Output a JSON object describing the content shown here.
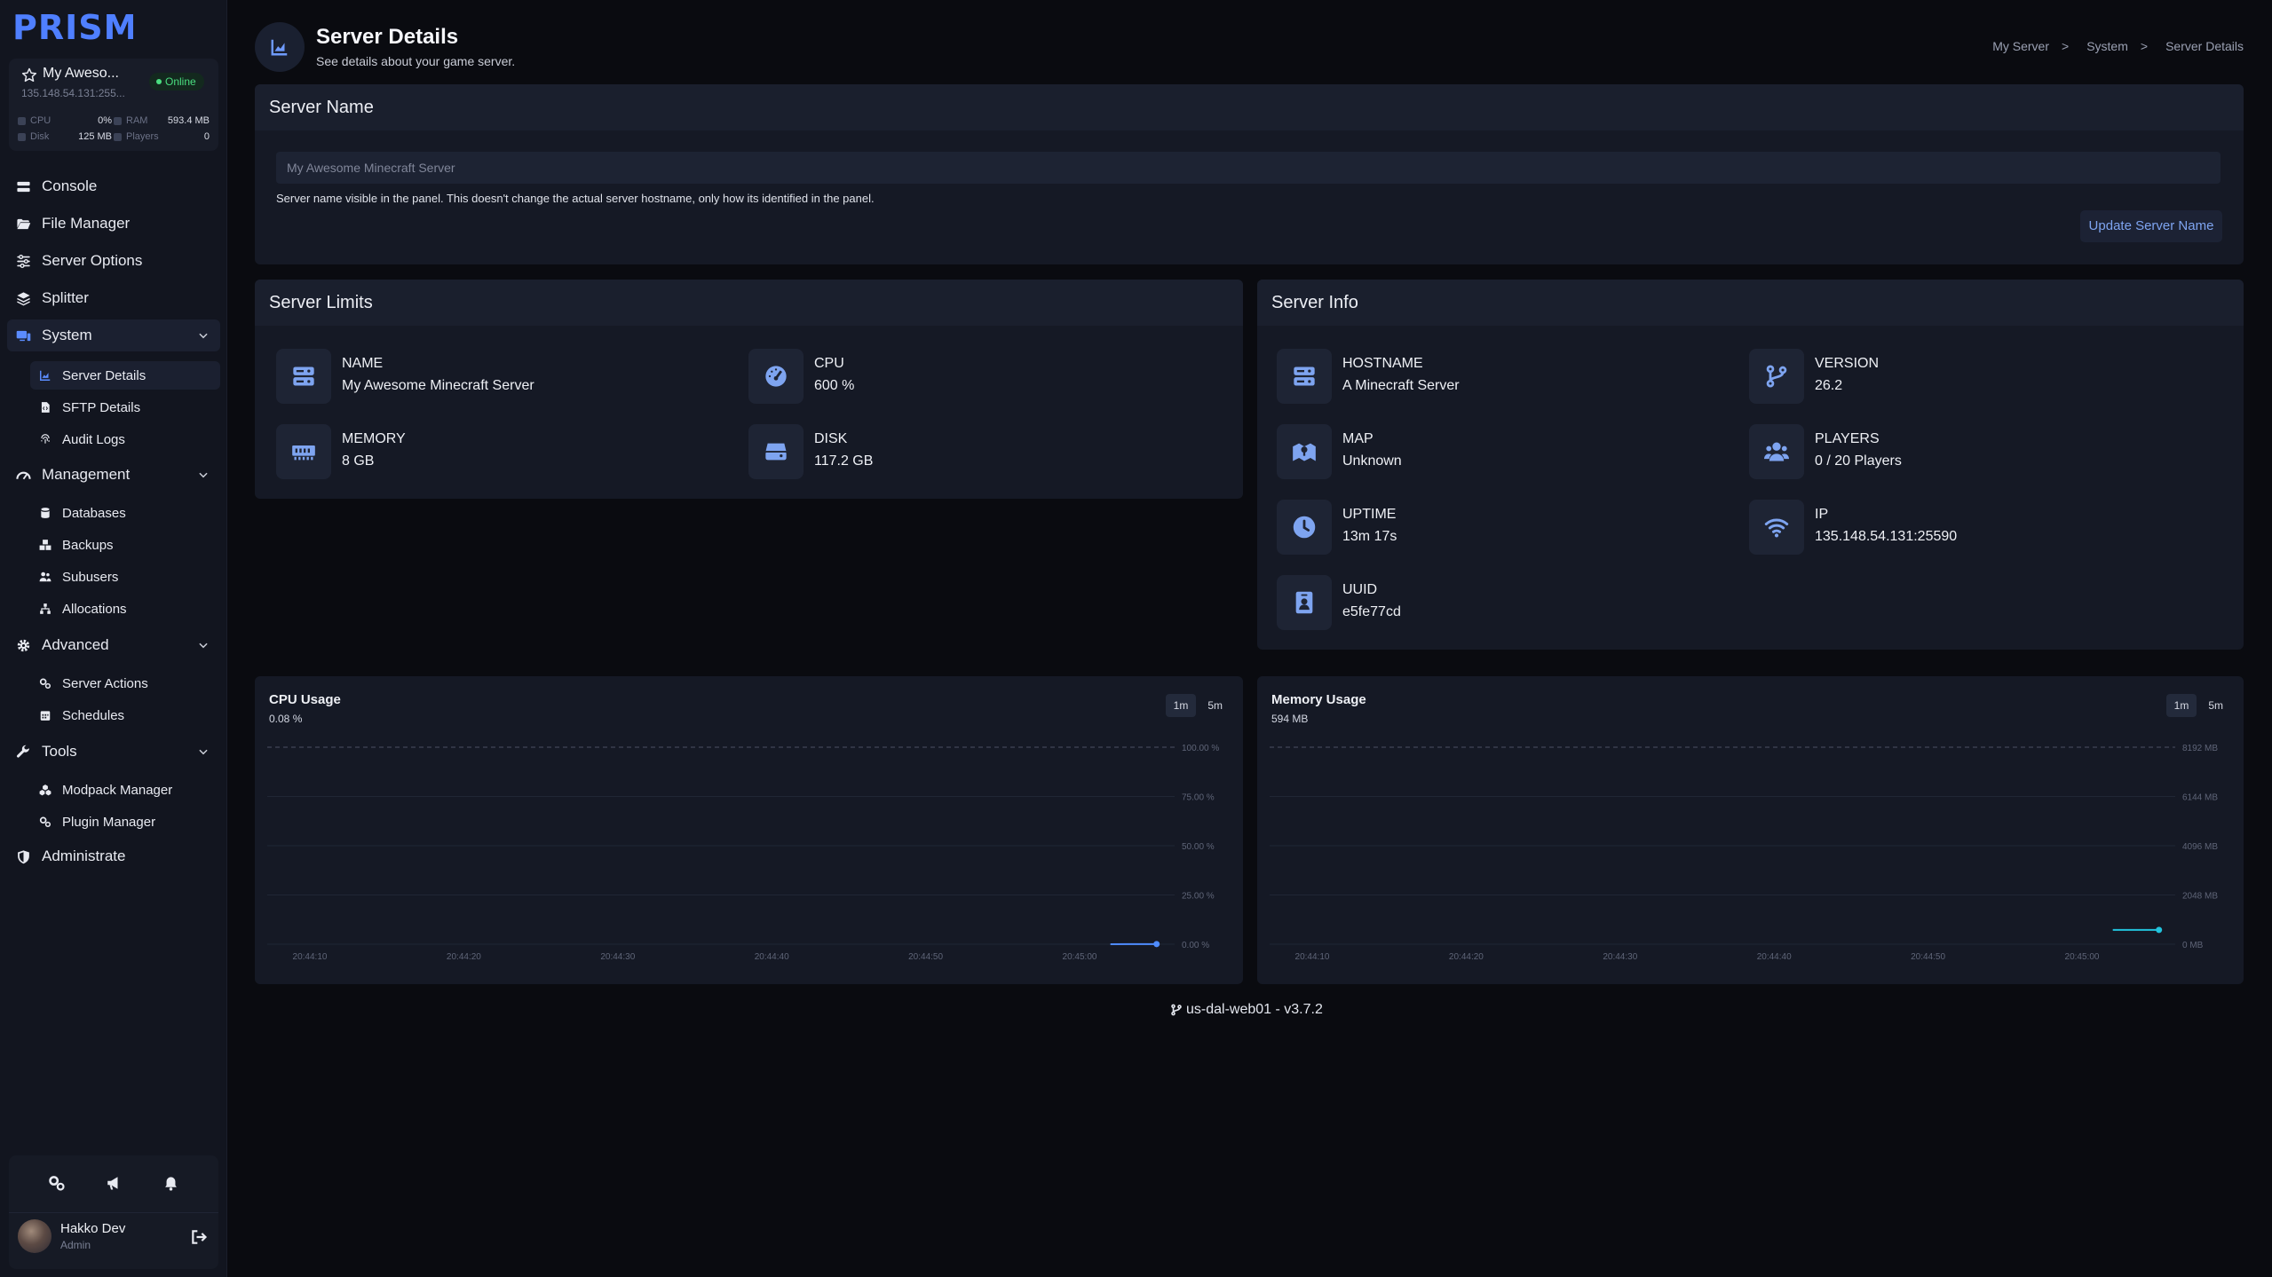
{
  "brand": {
    "name": "PRISM",
    "accent": "#4f7fff"
  },
  "server_card": {
    "name": "My Aweso...",
    "address": "135.148.54.131:255...",
    "status": "Online",
    "stats": {
      "cpu_label": "CPU",
      "cpu": "0%",
      "ram_label": "RAM",
      "ram": "593.4 MB",
      "disk_label": "Disk",
      "disk": "125 MB",
      "players_label": "Players",
      "players": "0"
    }
  },
  "nav": {
    "console": "Console",
    "file_manager": "File Manager",
    "server_options": "Server Options",
    "splitter": "Splitter",
    "system": "System",
    "system_items": [
      "Server Details",
      "SFTP Details",
      "Audit Logs"
    ],
    "management": "Management",
    "management_items": [
      "Databases",
      "Backups",
      "Subusers",
      "Allocations"
    ],
    "advanced": "Advanced",
    "advanced_items": [
      "Server Actions",
      "Schedules"
    ],
    "tools": "Tools",
    "tools_items": [
      "Modpack Manager",
      "Plugin Manager"
    ],
    "administrate": "Administrate"
  },
  "user": {
    "name": "Hakko Dev",
    "role": "Admin"
  },
  "header": {
    "title": "Server Details",
    "subtitle": "See details about your game server.",
    "breadcrumb": [
      "My Server",
      "System",
      "Server Details"
    ],
    "breadcrumb_sep": ">"
  },
  "server_name": {
    "title": "Server Name",
    "placeholder": "My Awesome Minecraft Server",
    "help": "Server name visible in the panel. This doesn't change the actual server hostname, only how its identified in the panel.",
    "button": "Update Server Name"
  },
  "limits": {
    "title": "Server Limits",
    "items": [
      {
        "label": "NAME",
        "value": "My Awesome Minecraft Server",
        "icon": "server-icon"
      },
      {
        "label": "CPU",
        "value": "600 %",
        "icon": "gauge-icon"
      },
      {
        "label": "MEMORY",
        "value": "8 GB",
        "icon": "memory-icon"
      },
      {
        "label": "DISK",
        "value": "117.2 GB",
        "icon": "hdd-icon"
      }
    ]
  },
  "info": {
    "title": "Server Info",
    "items": [
      {
        "label": "HOSTNAME",
        "value": "A Minecraft Server",
        "icon": "server-icon"
      },
      {
        "label": "VERSION",
        "value": "26.2",
        "icon": "code-branch-icon"
      },
      {
        "label": "MAP",
        "value": "Unknown",
        "icon": "map-icon"
      },
      {
        "label": "PLAYERS",
        "value": "0 / 20 Players",
        "icon": "users-icon"
      },
      {
        "label": "UPTIME",
        "value": "13m 17s",
        "icon": "clock-icon"
      },
      {
        "label": "IP",
        "value": "135.148.54.131:25590",
        "icon": "wifi-icon"
      },
      {
        "label": "UUID",
        "value": "e5fe77cd",
        "icon": "id-badge-icon"
      }
    ]
  },
  "cpu_chart": {
    "title": "CPU Usage",
    "current": "0.08 %",
    "ranges": [
      "1m",
      "5m"
    ]
  },
  "memory_chart": {
    "title": "Memory Usage",
    "current": "594 MB",
    "ranges": [
      "1m",
      "5m"
    ]
  },
  "chart_data": [
    {
      "type": "line",
      "title": "CPU Usage",
      "x_ticks": [
        "20:44:10",
        "20:44:20",
        "20:44:30",
        "20:44:40",
        "20:44:50",
        "20:45:00"
      ],
      "y_ticks": [
        "100.00 %",
        "75.00 %",
        "50.00 %",
        "25.00 %",
        "0.00 %"
      ],
      "ylim": [
        0,
        100
      ],
      "x": [
        "20:45:02",
        "20:45:05"
      ],
      "values": [
        0.0,
        0.08
      ],
      "color": "#4f8cff"
    },
    {
      "type": "line",
      "title": "Memory Usage",
      "x_ticks": [
        "20:44:10",
        "20:44:20",
        "20:44:30",
        "20:44:40",
        "20:44:50",
        "20:45:00"
      ],
      "y_ticks": [
        "8192 MB",
        "6144 MB",
        "4096 MB",
        "2048 MB",
        "0 MB"
      ],
      "ylim": [
        0,
        8192
      ],
      "x": [
        "20:45:02",
        "20:45:05"
      ],
      "values": [
        594,
        594
      ],
      "color": "#22c3dd"
    }
  ],
  "footer": {
    "text": "us-dal-web01 - v3.7.2"
  }
}
